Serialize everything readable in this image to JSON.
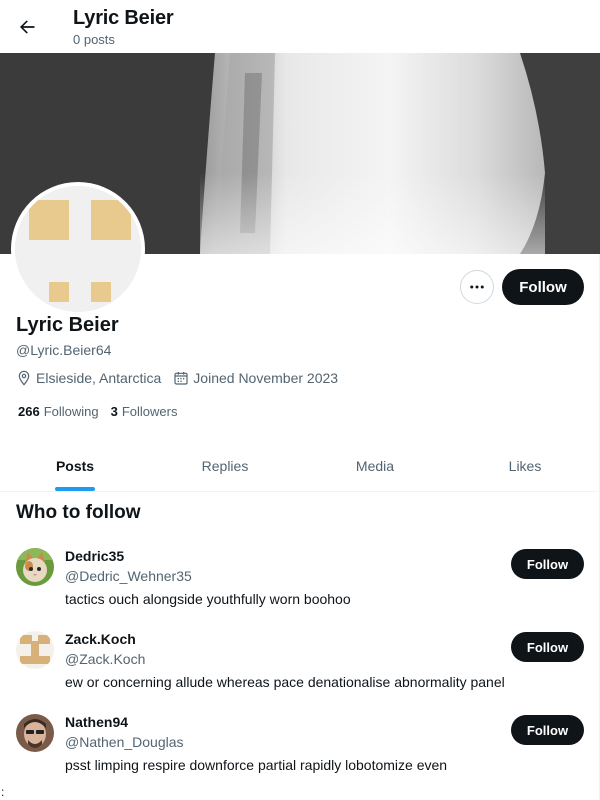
{
  "header": {
    "title": "Lyric Beier",
    "subtitle": "0 posts"
  },
  "profile": {
    "name": "Lyric Beier",
    "handle": "@Lyric.Beier64",
    "location": "Elsieside, Antarctica",
    "joined": "Joined November 2023",
    "following_count": "266",
    "following_label": "Following",
    "followers_count": "3",
    "followers_label": "Followers",
    "follow_label": "Follow"
  },
  "tabs": [
    {
      "label": "Posts",
      "active": true
    },
    {
      "label": "Replies",
      "active": false
    },
    {
      "label": "Media",
      "active": false
    },
    {
      "label": "Likes",
      "active": false
    }
  ],
  "who_to_follow": {
    "title": "Who to follow",
    "users": [
      {
        "name": "Dedric35",
        "handle": "@Dedric_Wehner35",
        "bio": "tactics ouch alongside youthfully worn boohoo",
        "follow_label": "Follow",
        "avatar": "cat-avatar"
      },
      {
        "name": "Zack.Koch",
        "handle": "@Zack.Koch",
        "bio": "ew or concerning allude whereas pace denationalise abnormality panel",
        "follow_label": "Follow",
        "avatar": "pattern-avatar"
      },
      {
        "name": "Nathen94",
        "handle": "@Nathen_Douglas",
        "bio": "psst limping respire downforce partial rapidly lobotomize even",
        "follow_label": "Follow",
        "avatar": "person-avatar"
      }
    ]
  },
  "stray_text": ":",
  "colors": {
    "accent": "#1d9bf0",
    "text": "#0f1419",
    "secondary": "#536471",
    "button": "#0f1419"
  }
}
